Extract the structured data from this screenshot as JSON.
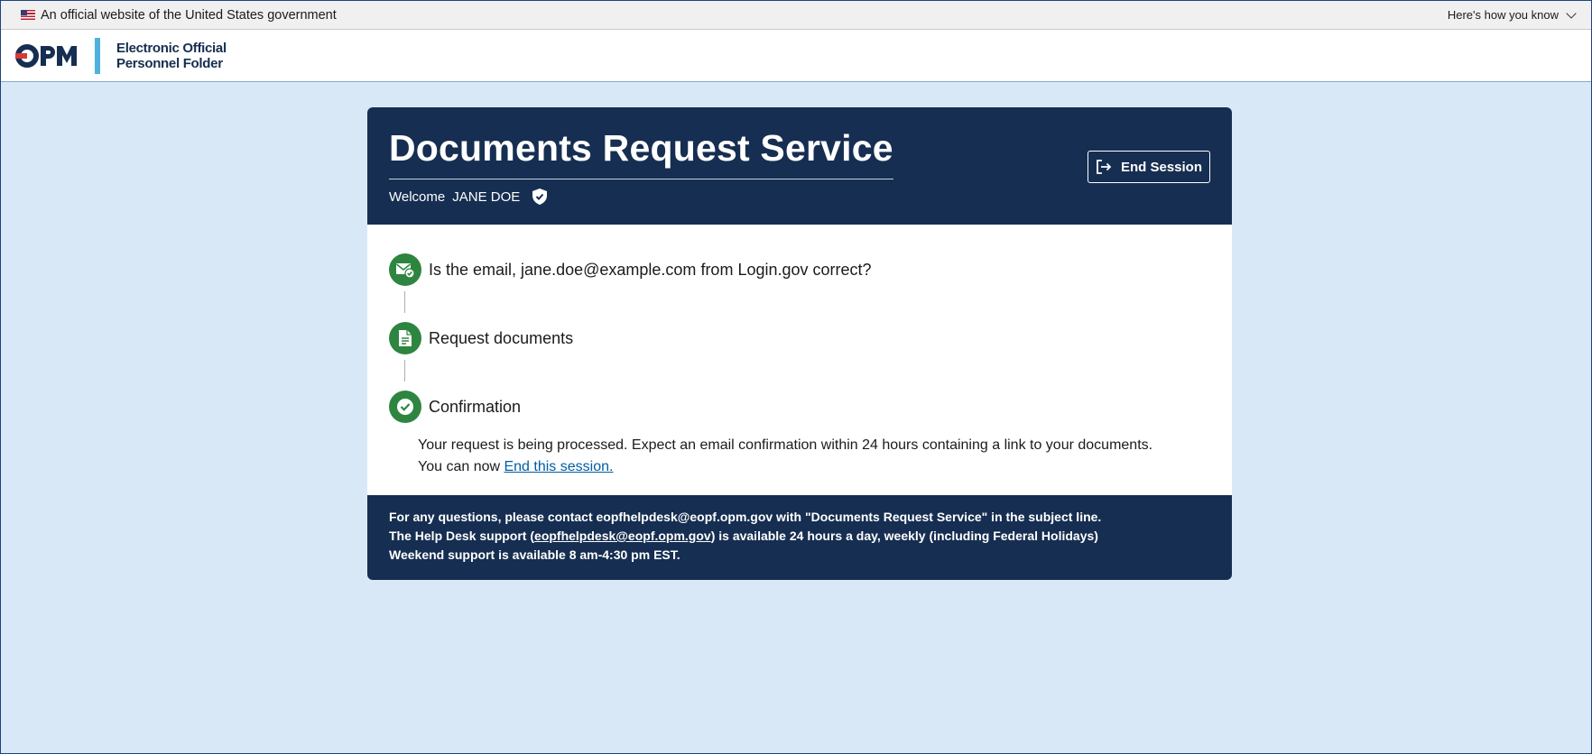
{
  "gov_banner": {
    "text": "An official website of the United States government",
    "toggle_label": "Here's how you know"
  },
  "header": {
    "logo_mark": "OPM",
    "logo_line1": "Electronic Official",
    "logo_line2": "Personnel Folder"
  },
  "card": {
    "title": "Documents Request Service",
    "welcome_label": "Welcome",
    "user_name": "JANE DOE",
    "end_session_label": "End Session",
    "steps": [
      {
        "label_prefix": "Is the email, ",
        "email": "jane.doe@example.com",
        "label_suffix": " from Login.gov correct?",
        "icon": "email-check-icon"
      },
      {
        "label": "Request documents",
        "icon": "document-icon"
      },
      {
        "label": "Confirmation",
        "icon": "check-icon"
      }
    ],
    "confirmation_message": "Your request is being processed. Expect an email confirmation within 24 hours containing a link to your documents.",
    "end_prompt": "You can now ",
    "end_link": "End this session.",
    "footer": {
      "line1": "For any questions, please contact eopfhelpdesk@eopf.opm.gov with \"Documents Request Service\" in the subject line.",
      "line2_prefix": "The Help Desk support (",
      "line2_link": "eopfhelpdesk@eopf.opm.gov",
      "line2_suffix": ") is available 24 hours a day, weekly (including Federal Holidays)",
      "line3": "Weekend support is available 8 am-4:30 pm EST."
    }
  },
  "colors": {
    "page_bg": "#d9e8f6",
    "navy": "#162e51",
    "success_green": "#2e8540",
    "link_blue": "#005ea2",
    "accent_blue": "#4fb0e0"
  }
}
